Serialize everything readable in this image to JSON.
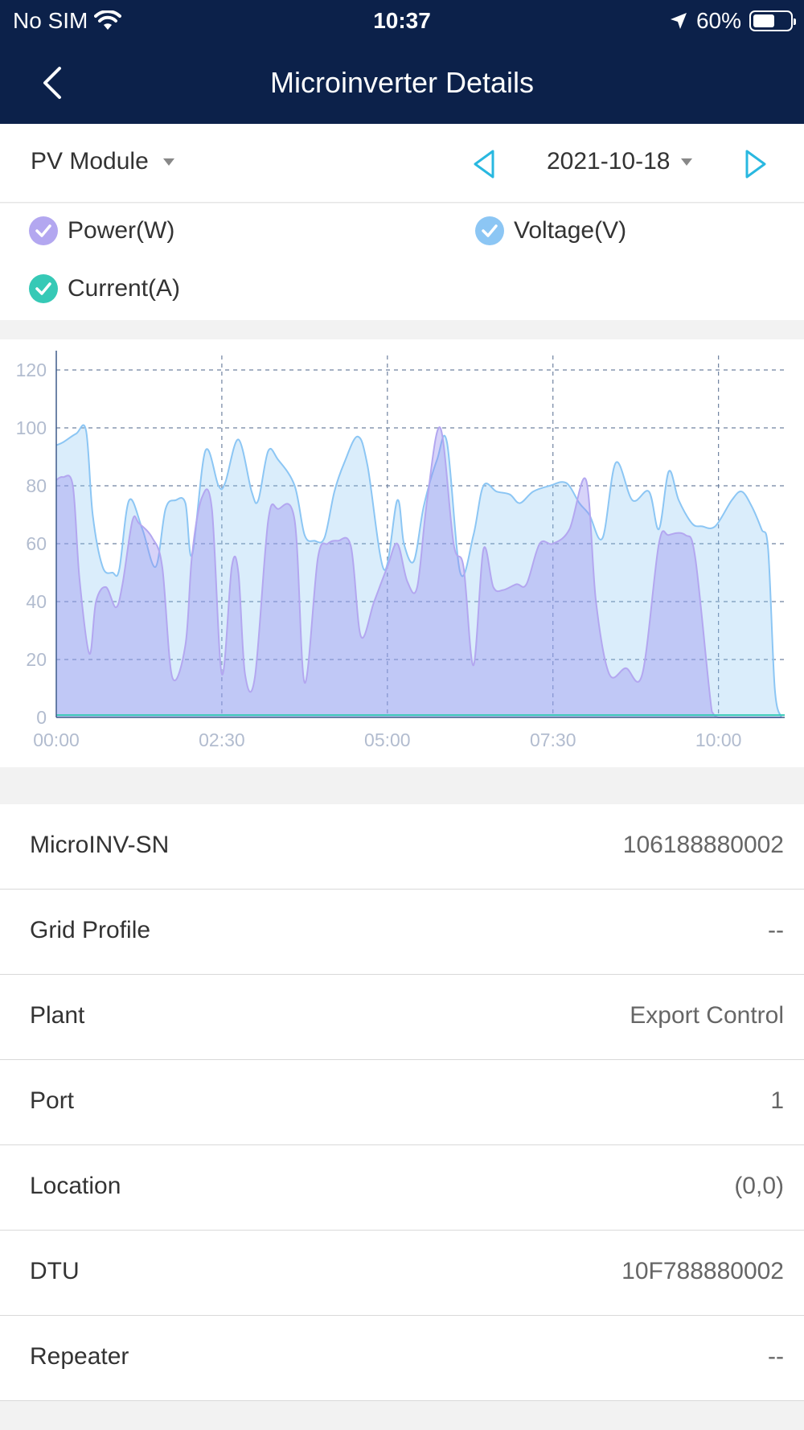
{
  "status_bar": {
    "carrier": "No SIM",
    "time": "10:37",
    "battery": "60%",
    "battery_level": 0.6
  },
  "nav": {
    "title": "Microinverter Details"
  },
  "filters": {
    "module": "PV Module",
    "date": "2021-10-18"
  },
  "legend": [
    {
      "label": "Power(W)",
      "color": "#b3a7f0",
      "checked": true
    },
    {
      "label": "Voltage(V)",
      "color": "#8cc6f4",
      "checked": true
    },
    {
      "label": "Current(A)",
      "color": "#36c9b6",
      "checked": true
    }
  ],
  "chart_data": {
    "type": "area",
    "x_tick_labels": [
      "00:00",
      "02:30",
      "05:00",
      "07:30",
      "10:00"
    ],
    "x_range_hours": [
      0,
      11
    ],
    "ylim": [
      0,
      125
    ],
    "y_ticks": [
      0,
      20,
      40,
      60,
      80,
      100,
      120
    ],
    "grid": true,
    "series": [
      {
        "name": "Voltage(V)",
        "color": "#8cc6f4",
        "x": [
          0,
          0.1,
          0.3,
          0.45,
          0.55,
          0.7,
          0.85,
          0.95,
          1.1,
          1.3,
          1.5,
          1.65,
          1.8,
          1.95,
          2.05,
          2.25,
          2.45,
          2.55,
          2.75,
          2.95,
          3.05,
          3.2,
          3.35,
          3.6,
          3.75,
          3.9,
          4.05,
          4.2,
          4.35,
          4.55,
          4.7,
          4.95,
          5.15,
          5.25,
          5.4,
          5.55,
          5.75,
          5.9,
          6.1,
          6.3,
          6.45,
          6.65,
          6.85,
          7.0,
          7.2,
          7.45,
          7.7,
          7.9,
          8.05,
          8.25,
          8.45,
          8.7,
          8.95,
          9.1,
          9.25,
          9.4,
          9.6,
          9.75,
          9.95,
          10.2,
          10.35,
          10.5,
          10.65,
          10.75,
          10.85,
          10.95
        ],
        "y": [
          94,
          95,
          98,
          99,
          70,
          52,
          50,
          51,
          75,
          65,
          52,
          72,
          75,
          74,
          56,
          92,
          80,
          81,
          96,
          78,
          75,
          92,
          89,
          80,
          63,
          61,
          62,
          78,
          88,
          97,
          87,
          51,
          75,
          60,
          54,
          73,
          89,
          95,
          50,
          63,
          80,
          78,
          77,
          74,
          78,
          80,
          81,
          74,
          70,
          62,
          88,
          75,
          78,
          65,
          85,
          75,
          67,
          66,
          66,
          75,
          78,
          73,
          65,
          58,
          10,
          0
        ]
      },
      {
        "name": "Power(W)",
        "color": "#b3a7f0",
        "x": [
          0,
          0.1,
          0.25,
          0.35,
          0.5,
          0.6,
          0.75,
          0.9,
          1.0,
          1.15,
          1.25,
          1.45,
          1.6,
          1.75,
          1.95,
          2.05,
          2.2,
          2.35,
          2.5,
          2.65,
          2.75,
          2.85,
          3.0,
          3.2,
          3.35,
          3.6,
          3.75,
          3.95,
          4.1,
          4.25,
          4.45,
          4.6,
          4.8,
          5.0,
          5.15,
          5.3,
          5.45,
          5.6,
          5.8,
          6.0,
          6.15,
          6.3,
          6.45,
          6.6,
          6.75,
          6.95,
          7.1,
          7.3,
          7.5,
          7.75,
          8.0,
          8.15,
          8.35,
          8.6,
          8.85,
          9.1,
          9.25,
          9.5,
          9.65,
          9.9,
          10.0,
          10.2,
          10.4,
          10.55,
          10.7,
          10.85,
          10.95
        ],
        "y": [
          82,
          83,
          80,
          48,
          22,
          40,
          45,
          38,
          46,
          68,
          67,
          62,
          52,
          14,
          25,
          56,
          76,
          72,
          15,
          52,
          50,
          15,
          14,
          68,
          72,
          68,
          12,
          55,
          60,
          61,
          59,
          28,
          40,
          52,
          60,
          47,
          45,
          75,
          100,
          60,
          52,
          18,
          58,
          45,
          44,
          46,
          46,
          60,
          60,
          65,
          82,
          40,
          15,
          17,
          15,
          60,
          63,
          63,
          55,
          2,
          0,
          0,
          0,
          0,
          0,
          0,
          0
        ]
      },
      {
        "name": "Current(A)",
        "color": "#36c9b6",
        "x": [
          0,
          11
        ],
        "y": [
          0.8,
          0.8
        ]
      }
    ]
  },
  "info": [
    {
      "label": "MicroINV-SN",
      "value": "106188880002"
    },
    {
      "label": "Grid Profile",
      "value": "--"
    },
    {
      "label": "Plant",
      "value": "Export Control"
    },
    {
      "label": "Port",
      "value": "1"
    },
    {
      "label": "Location",
      "value": "(0,0)"
    },
    {
      "label": "DTU",
      "value": "10F788880002"
    },
    {
      "label": "Repeater",
      "value": "--"
    }
  ]
}
